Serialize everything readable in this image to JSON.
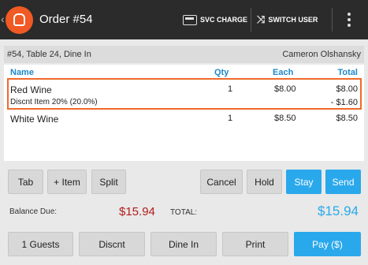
{
  "topbar": {
    "title": "Order #54",
    "svc_charge_label": "SVC CHARGE",
    "switch_user_label": "SWITCH USER"
  },
  "order": {
    "info": "#54, Table 24, Dine In",
    "server": "Cameron Olshansky"
  },
  "columns": {
    "name": "Name",
    "qty": "Qty",
    "each": "Each",
    "total": "Total"
  },
  "items": [
    {
      "name": "Red Wine",
      "qty": "1",
      "each": "$8.00",
      "total": "$8.00",
      "discount_label": "Discnt Item 20% (20.0%)",
      "discount_amount": "- $1.60"
    },
    {
      "name": "White Wine",
      "qty": "1",
      "each": "$8.50",
      "total": "$8.50"
    }
  ],
  "actions": {
    "tab": "Tab",
    "add_item": "+ Item",
    "split": "Split",
    "cancel": "Cancel",
    "hold": "Hold",
    "stay": "Stay",
    "send": "Send"
  },
  "totals": {
    "balance_label": "Balance Due:",
    "balance_value": "$15.94",
    "total_label": "TOTAL:",
    "total_value": "$15.94"
  },
  "bottom": {
    "guests": "1 Guests",
    "discount": "Discnt",
    "dine_in": "Dine In",
    "print": "Print",
    "pay": "Pay ($)"
  },
  "colors": {
    "accent_orange": "#ef6a2b",
    "accent_blue": "#2aa8ec",
    "balance_red": "#b31c1c",
    "topbar": "#2b2b2b"
  }
}
